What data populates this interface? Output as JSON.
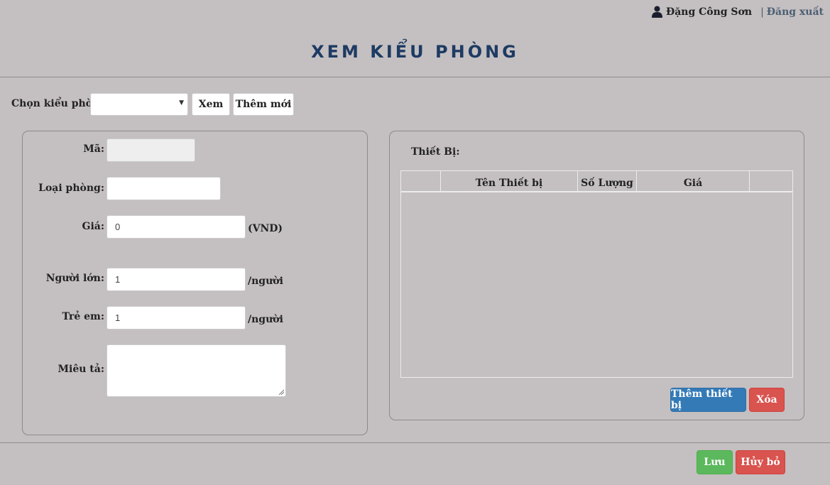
{
  "header": {
    "user_name": "Đặng Công Sơn",
    "separator": "|",
    "logout_label": "Đăng xuất",
    "title": "XEM KIỂU PHÒNG"
  },
  "chooser": {
    "label": "Chọn kiểu phòng:",
    "selected_value": "",
    "view_label": "Xem",
    "add_new_label": "Thêm mới"
  },
  "form": {
    "code": {
      "label": "Mã:",
      "value": ""
    },
    "room_type": {
      "label": "Loại phòng:",
      "value": ""
    },
    "price": {
      "label": "Giá:",
      "value": "0",
      "unit": "(VND)"
    },
    "adults": {
      "label": "Người lớn:",
      "value": "1",
      "unit": "/người"
    },
    "children": {
      "label": "Trẻ em:",
      "value": "1",
      "unit": "/người"
    },
    "description": {
      "label": "Miêu tả:",
      "value": ""
    }
  },
  "equipment": {
    "title": "Thiết Bị:",
    "columns": [
      "",
      "Tên Thiết bị",
      "Số Lượng",
      "Giá",
      ""
    ],
    "rows": [],
    "add_label": "Thêm thiết bị",
    "delete_label": "Xóa"
  },
  "footer": {
    "save_label": "Lưu",
    "cancel_label": "Hủy bỏ"
  },
  "colors": {
    "background": "#c4bfc1",
    "title": "#1d3b63",
    "primary": "#337ab7",
    "danger": "#d9534f",
    "success": "#5cb85c"
  },
  "icons": {
    "user": "user-icon"
  }
}
